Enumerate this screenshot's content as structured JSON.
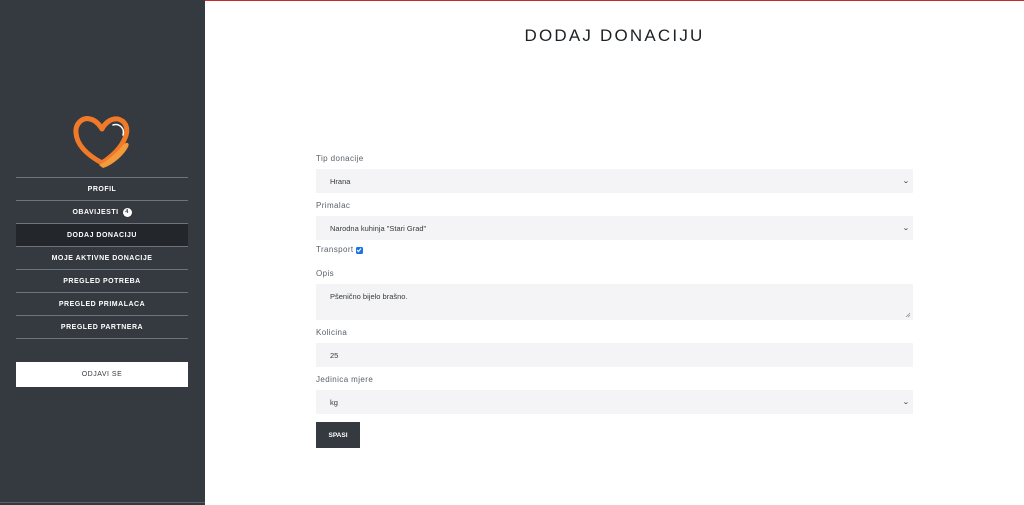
{
  "sidebar": {
    "nav": [
      {
        "label": "PROFIL"
      },
      {
        "label": "OBAVIJESTI",
        "badge": "4"
      },
      {
        "label": "DODAJ DONACIJU",
        "active": true
      },
      {
        "label": "MOJE AKTIVNE DONACIJE"
      },
      {
        "label": "PREGLED POTREBA"
      },
      {
        "label": "PREGLED PRIMALACA"
      },
      {
        "label": "PREGLED PARTNERA"
      }
    ],
    "logout_label": "ODJAVI SE"
  },
  "page": {
    "title": "DODAJ DONACIJU"
  },
  "form": {
    "tip_label": "Tip donacije",
    "tip_value": "Hrana",
    "primalac_label": "Primalac",
    "primalac_value": "Narodna kuhinja \"Stari Grad\"",
    "transport_label": "Transport",
    "transport_checked": true,
    "opis_label": "Opis",
    "opis_value": "Pšenično bijelo brašno.",
    "kolicina_label": "Kolicina",
    "kolicina_value": "25",
    "jedinica_label": "Jedinica mjere",
    "jedinica_value": "kg",
    "save_label": "SPASI"
  },
  "colors": {
    "sidebar": "#343a40",
    "accent": "#c92a2a",
    "logo_orange": "#f07a28"
  }
}
